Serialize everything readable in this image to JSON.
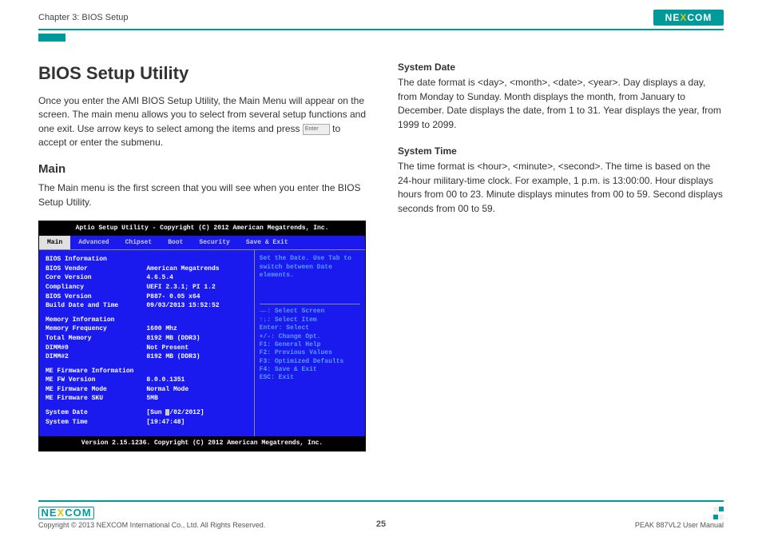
{
  "header": {
    "chapter": "Chapter 3: BIOS Setup",
    "logo_pre": "NE",
    "logo_x": "X",
    "logo_post": "COM"
  },
  "left": {
    "h1": "BIOS Setup Utility",
    "intro_a": "Once you enter the AMI BIOS Setup Utility, the Main Menu will appear on the screen. The main menu allows you to select from several setup functions and one exit. Use arrow keys to select among the items and press ",
    "enter_label": "Enter",
    "intro_b": " to accept or enter the submenu.",
    "h2": "Main",
    "main_text": "The Main menu is the first screen that you will see when you enter the BIOS Setup Utility."
  },
  "right": {
    "sd_head": "System Date",
    "sd_text": "The date format is <day>, <month>, <date>, <year>. Day displays a day, from Monday to Sunday. Month displays the month, from January to December. Date displays the date, from 1 to 31. Year displays the year, from 1999 to 2099.",
    "st_head": "System Time",
    "st_text": "The time format is <hour>, <minute>, <second>. The time is based on the 24-hour military-time clock. For example, 1 p.m. is 13:00:00. Hour displays hours from 00 to 23. Minute displays minutes from 00 to 59. Second displays seconds from 00 to 59."
  },
  "bios": {
    "title": "Aptio Setup Utility - Copyright (C) 2012 American Megatrends, Inc.",
    "tabs": [
      "Main",
      "Advanced",
      "Chipset",
      "Boot",
      "Security",
      "Save & Exit"
    ],
    "rows": {
      "info_hdr": "BIOS Information",
      "vendor_l": "BIOS Vendor",
      "vendor_v": "American Megatrends",
      "core_l": "Core Version",
      "core_v": "4.6.5.4",
      "comp_l": "Compliancy",
      "comp_v": "UEFI 2.3.1; PI 1.2",
      "biosver_l": "BIOS Version",
      "biosver_v": "P887- 0.05 x64",
      "build_l": "Build Date and Time",
      "build_v": "09/03/2013 15:52:52",
      "mem_hdr": "Memory Information",
      "memfreq_l": "Memory Frequency",
      "memfreq_v": "1600 Mhz",
      "totmem_l": "Total Memory",
      "totmem_v": "8192 MB (DDR3)",
      "dimm0_l": "DIMM#0",
      "dimm0_v": "Not Present",
      "dimm2_l": "DIMM#2",
      "dimm2_v": "8192 MB (DDR3)",
      "me_hdr": "ME Firmware Information",
      "mefw_l": "ME FW Version",
      "mefw_v": "8.0.0.1351",
      "memode_l": "ME Firmware Mode",
      "memode_v": "Normal Mode",
      "mesku_l": "ME Firmware SKU",
      "mesku_v": "5MB",
      "sdate_l": "System Date",
      "sdate_v1": "[Sun ",
      "sdate_v2": "/02/2012]",
      "stime_l": "System Time",
      "stime_v": "[19:47:48]"
    },
    "help": "Set the Date. Use Tab to switch between Date elements.",
    "keys": {
      "k1": "→←: Select Screen",
      "k2": "↑↓: Select Item",
      "k3": "Enter: Select",
      "k4": "+/-: Change Opt.",
      "k5": "F1: General Help",
      "k6": "F2: Previous Values",
      "k7": "F3: Optimized Defaults",
      "k8": "F4: Save & Exit",
      "k9": "ESC: Exit"
    },
    "footer": "Version 2.15.1236. Copyright (C) 2012 American Megatrends, Inc."
  },
  "footer": {
    "copyright": "Copyright © 2013 NEXCOM International Co., Ltd. All Rights Reserved.",
    "page": "25",
    "manual": "PEAK 887VL2 User Manual"
  }
}
